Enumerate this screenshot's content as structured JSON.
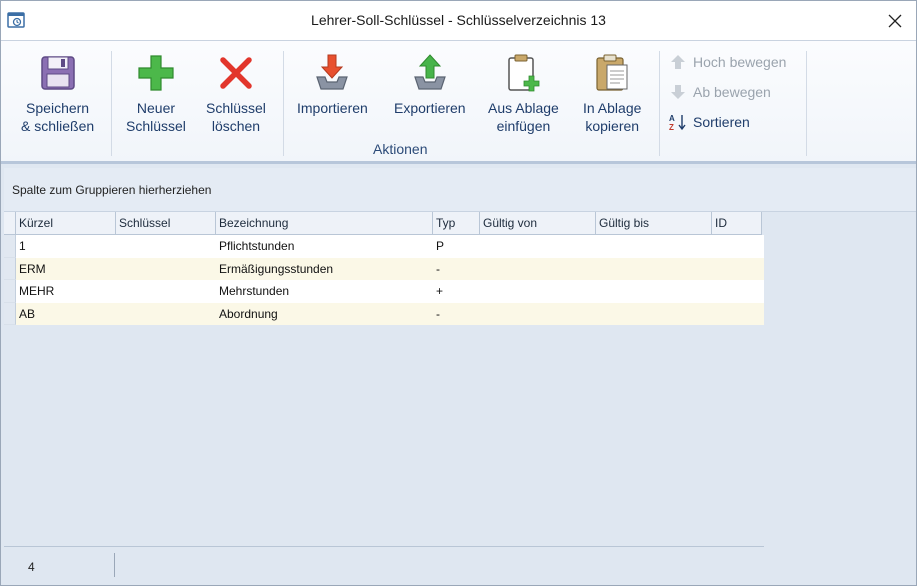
{
  "window": {
    "title": "Lehrer-Soll-Schlüssel - Schlüsselverzeichnis 13"
  },
  "ribbon": {
    "save_line1": "Speichern",
    "save_line2": "& schließen",
    "new_line1": "Neuer",
    "new_line2": "Schlüssel",
    "delete_line1": "Schlüssel",
    "delete_line2": "löschen",
    "import_label": "Importieren",
    "export_label": "Exportieren",
    "paste_line1": "Aus Ablage",
    "paste_line2": "einfügen",
    "copy_line1": "In Ablage",
    "copy_line2": "kopieren",
    "move_up_label": "Hoch bewegen",
    "move_down_label": "Ab bewegen",
    "sort_label": "Sortieren",
    "group_label": "Aktionen"
  },
  "grid": {
    "group_hint": "Spalte zum Gruppieren hierherziehen",
    "columns": [
      "Kürzel",
      "Schlüssel",
      "Bezeichnung",
      "Typ",
      "Gültig von",
      "Gültig bis",
      "ID"
    ],
    "rows": [
      [
        "1",
        "",
        "Pflichtstunden",
        "P",
        "",
        "",
        ""
      ],
      [
        "ERM",
        "",
        "Ermäßigungsstunden",
        "-",
        "",
        "",
        ""
      ],
      [
        "MEHR",
        "",
        "Mehrstunden",
        "+",
        "",
        "",
        ""
      ],
      [
        "AB",
        "",
        "Abordnung",
        "-",
        "",
        "",
        ""
      ]
    ]
  },
  "status": {
    "count": "4"
  },
  "colors": {
    "accent": "#1f3d6b",
    "row_alt": "#fbf8e7",
    "background": "#dfe7f1"
  }
}
